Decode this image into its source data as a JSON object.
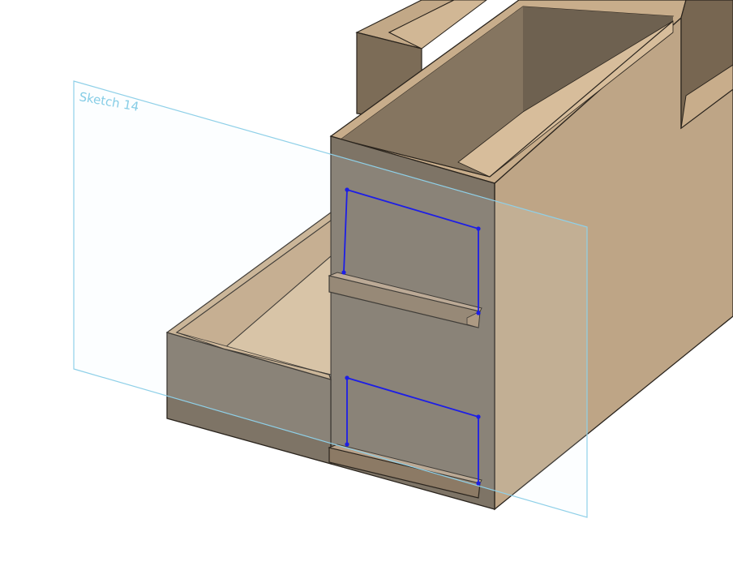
{
  "viewport": {
    "background": "#ffffff"
  },
  "sketch": {
    "name": "Sketch 14",
    "plane_color": "#8fd0e8",
    "profile_color": "#1d1ee6"
  },
  "model": {
    "material_color": "#bea586",
    "shadow_color": "#7e7466"
  }
}
